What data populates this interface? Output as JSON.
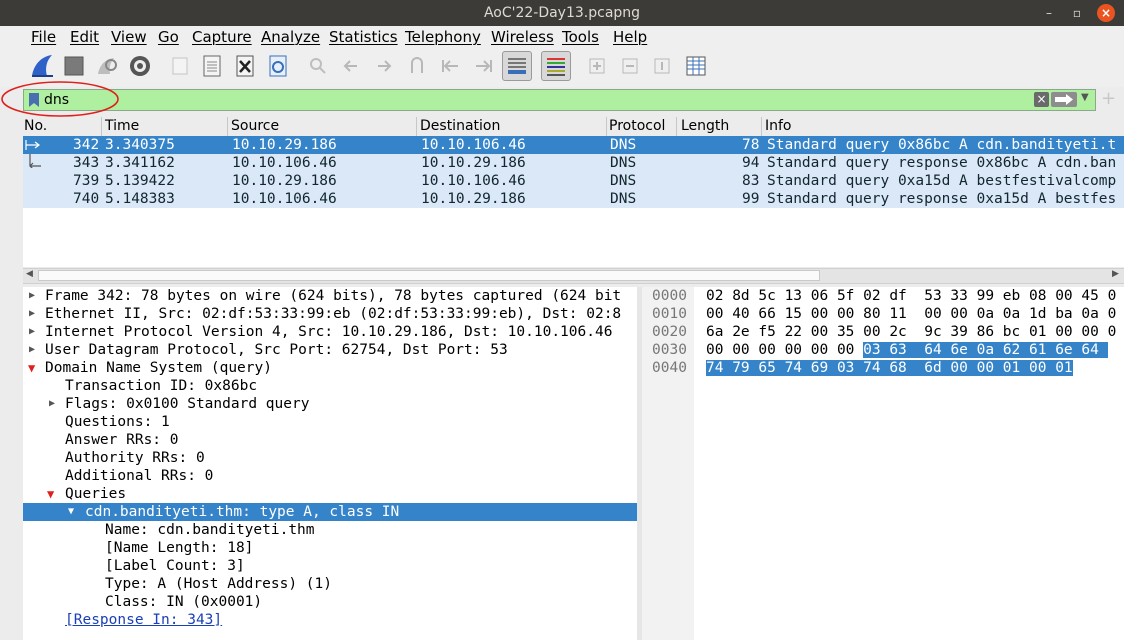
{
  "window": {
    "title": "AoC'22-Day13.pcapng"
  },
  "menu": [
    "File",
    "Edit",
    "View",
    "Go",
    "Capture",
    "Analyze",
    "Statistics",
    "Telephony",
    "Wireless",
    "Tools",
    "Help"
  ],
  "filter": {
    "value": "dns"
  },
  "columns": [
    "No.",
    "Time",
    "Source",
    "Destination",
    "Protocol",
    "Length",
    "Info"
  ],
  "packets": [
    {
      "no": "342",
      "time": "3.340375",
      "src": "10.10.29.186",
      "dst": "10.10.106.46",
      "proto": "DNS",
      "len": "78",
      "info": "Standard query 0x86bc A cdn.bandityeti.t"
    },
    {
      "no": "343",
      "time": "3.341162",
      "src": "10.10.106.46",
      "dst": "10.10.29.186",
      "proto": "DNS",
      "len": "94",
      "info": "Standard query response 0x86bc A cdn.ban"
    },
    {
      "no": "739",
      "time": "5.139422",
      "src": "10.10.29.186",
      "dst": "10.10.106.46",
      "proto": "DNS",
      "len": "83",
      "info": "Standard query 0xa15d A bestfestivalcomp"
    },
    {
      "no": "740",
      "time": "5.148383",
      "src": "10.10.106.46",
      "dst": "10.10.29.186",
      "proto": "DNS",
      "len": "99",
      "info": "Standard query response 0xa15d A bestfes"
    }
  ],
  "details": [
    "Frame 342: 78 bytes on wire (624 bits), 78 bytes captured (624 bit",
    "Ethernet II, Src: 02:df:53:33:99:eb (02:df:53:33:99:eb), Dst: 02:8",
    "Internet Protocol Version 4, Src: 10.10.29.186, Dst: 10.10.106.46",
    "User Datagram Protocol, Src Port: 62754, Dst Port: 53",
    "Domain Name System (query)",
    "Transaction ID: 0x86bc",
    "Flags: 0x0100 Standard query",
    "Questions: 1",
    "Answer RRs: 0",
    "Authority RRs: 0",
    "Additional RRs: 0",
    "Queries",
    "cdn.bandityeti.thm: type A, class IN",
    "Name: cdn.bandityeti.thm",
    "[Name Length: 18]",
    "[Label Count: 3]",
    "Type: A (Host Address) (1)",
    "Class: IN (0x0001)",
    "[Response In: 343]"
  ],
  "bytes": {
    "offsets": [
      "0000",
      "0010",
      "0020",
      "0030",
      "0040"
    ],
    "r0": "02 8d 5c 13 06 5f 02 df  53 33 99 eb 08 00 45 0",
    "r1": "00 40 66 15 00 00 80 11  00 00 0a 0a 1d ba 0a 0",
    "r2": "6a 2e f5 22 00 35 00 2c  9c 39 86 bc 01 00 00 0",
    "r3a": "00 00 00 00 00 00 ",
    "r3b": "03 63  64 6e 0a 62 61 6e 64 ",
    "r4": "74 79 65 74 69 03 74 68  6d 00 00 01 00 01"
  },
  "colors": {
    "selection": "#3584c9",
    "filter_bg": "#aff0a0",
    "row_bg": "#dae8f7",
    "annotation": "#e0201a"
  }
}
